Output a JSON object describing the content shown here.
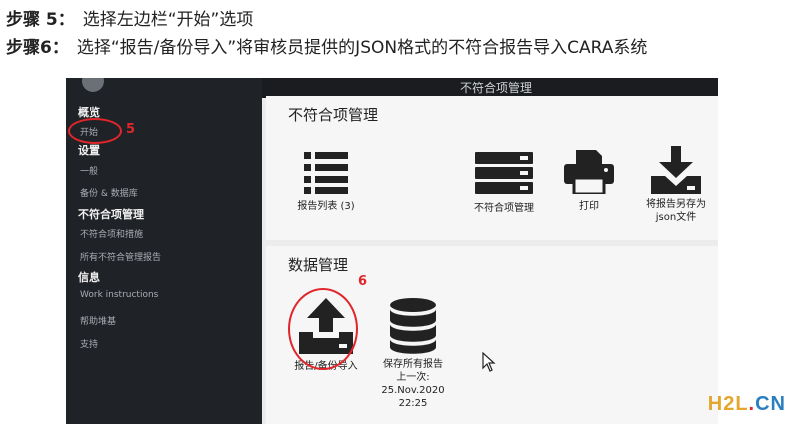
{
  "instructions": {
    "line1_step": "步骤 5：",
    "line1_text": "选择左边栏“开始”选项",
    "line2_step": "步骤6：",
    "line2_text": "选择“报告/备份导入”将审核员提供的JSON格式的不符合报告导入CARA系统"
  },
  "window": {
    "title": "不符合项管理"
  },
  "sidebar": {
    "sections": [
      {
        "heading": "概览",
        "items": [
          "开始"
        ]
      },
      {
        "heading": "设置",
        "items": [
          "一般",
          "备份 & 数据库"
        ]
      },
      {
        "heading": "不符合项管理",
        "items": [
          "不符合项和措施",
          "所有不符合管理报告"
        ]
      },
      {
        "heading": "信息",
        "items": [
          "Work instructions",
          "帮助堆基",
          "支持"
        ]
      }
    ]
  },
  "annotations": {
    "step5_number": "5",
    "step6_number": "6"
  },
  "panel_nc": {
    "title": "不符合项管理",
    "tiles": [
      {
        "icon": "list-icon",
        "label": "报告列表 (3)"
      },
      {
        "icon": "server-icon",
        "label": "不符合项管理"
      },
      {
        "icon": "printer-icon",
        "label": "打印"
      },
      {
        "icon": "download-icon",
        "label_line1": "将报告另存为",
        "label_line2": "json文件"
      }
    ]
  },
  "panel_data": {
    "title": "数据管理",
    "tiles": [
      {
        "icon": "upload-icon",
        "label": "报告/备份导入"
      },
      {
        "icon": "database-icon",
        "label_line1": "保存所有报告",
        "label_line2": "上一次:",
        "label_line3": "25.Nov.2020",
        "label_line4": "22:25"
      }
    ]
  },
  "watermark": {
    "part1": "H2L",
    "part2": ".",
    "part3": "CN"
  },
  "colors": {
    "sidebar_bg": "#1f2226",
    "annotation_red": "#e0262a",
    "panel_bg": "#f6f6f6"
  }
}
